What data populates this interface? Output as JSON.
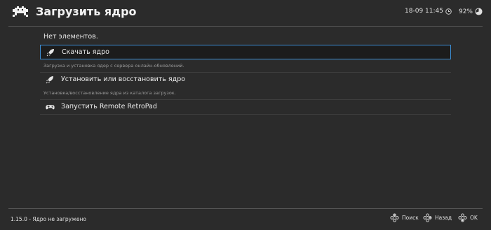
{
  "header": {
    "title": "Загрузить ядро",
    "datetime": "18-09 11:45",
    "battery": "92%"
  },
  "list": {
    "empty_text": "Нет элементов.",
    "items": [
      {
        "label": "Скачать ядро",
        "sublabel": "Загрузка и установка ядер с сервера онлайн-обновлений.",
        "icon": "rocket-icon",
        "selected": true
      },
      {
        "label": "Установить или восстановить ядро",
        "sublabel": "Установка/восстановление ядра из каталога загрузок.",
        "icon": "rocket-icon",
        "selected": false
      },
      {
        "label": "Запустить Remote RetroPad",
        "sublabel": "",
        "icon": "gamepad-icon",
        "selected": false
      }
    ]
  },
  "footer": {
    "version": "1.15.0 - Ядро не загружено",
    "buttons": [
      {
        "label": "Поиск",
        "icon": "dpad-icon"
      },
      {
        "label": "Назад",
        "icon": "dpad-icon"
      },
      {
        "label": "OK",
        "icon": "dpad-icon"
      }
    ]
  },
  "colors": {
    "background": "#2b2b2b",
    "selection_border": "#3d8fd6",
    "text": "#e6e6e6",
    "subtext": "#9a9a9a"
  }
}
